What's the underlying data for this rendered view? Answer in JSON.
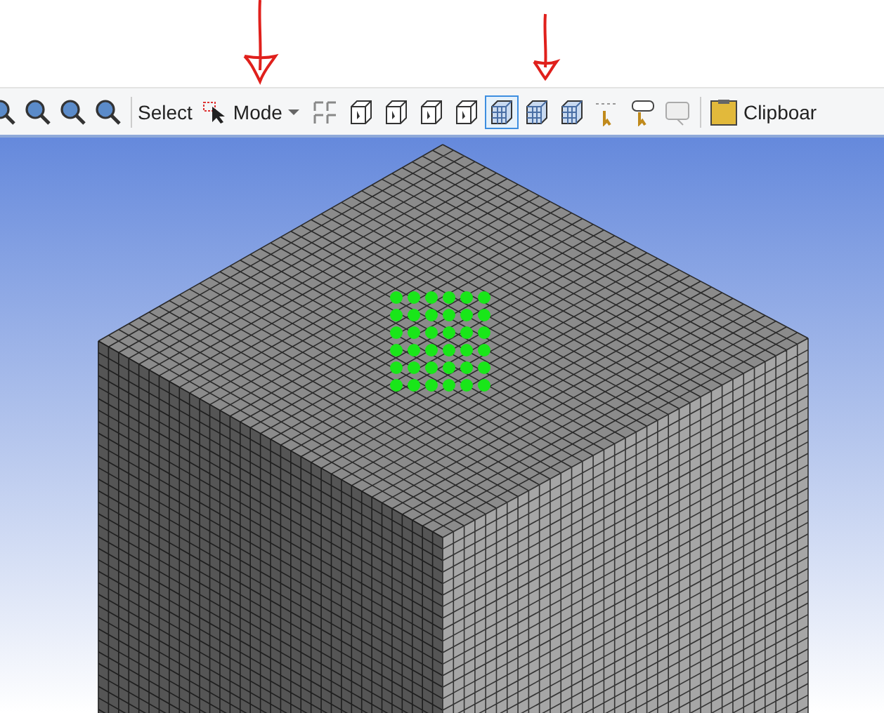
{
  "toolbar": {
    "items": [
      {
        "kind": "zoom",
        "selected": false
      },
      {
        "kind": "zoom",
        "selected": false
      },
      {
        "kind": "zoom",
        "selected": false
      },
      {
        "kind": "zoom",
        "selected": false
      },
      {
        "kind": "separator"
      },
      {
        "kind": "label",
        "text": "Select"
      },
      {
        "kind": "dropdown",
        "text": "Mode"
      },
      {
        "kind": "grid",
        "selected": false
      },
      {
        "kind": "box",
        "selected": false
      },
      {
        "kind": "box",
        "selected": false
      },
      {
        "kind": "box",
        "selected": false
      },
      {
        "kind": "box",
        "selected": false
      },
      {
        "kind": "mesh",
        "selected": true
      },
      {
        "kind": "mesh",
        "selected": false
      },
      {
        "kind": "mesh",
        "selected": false
      },
      {
        "kind": "xyz",
        "selected": false
      },
      {
        "kind": "tag",
        "selected": false
      },
      {
        "kind": "note",
        "selected": false
      },
      {
        "kind": "separator"
      },
      {
        "kind": "clipboard",
        "text": "Clipboar"
      }
    ]
  }
}
